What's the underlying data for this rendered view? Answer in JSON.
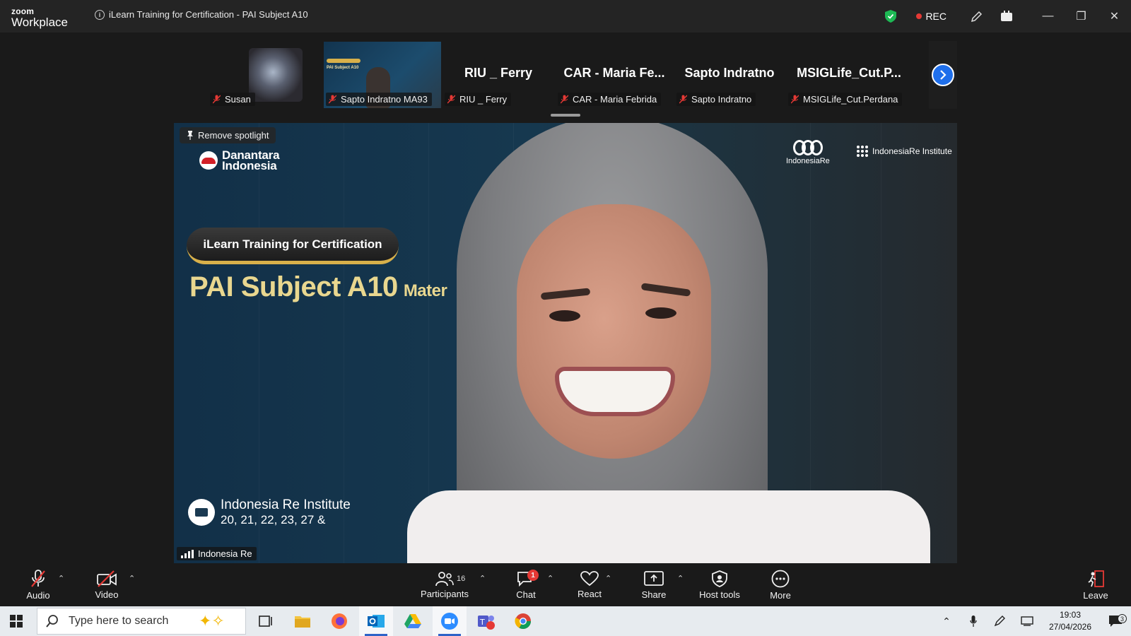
{
  "titlebar": {
    "brand_top": "zoom",
    "brand_bottom": "Workplace",
    "meeting_title": "iLearn Training for Certification - PAI Subject A10",
    "rec_label": "REC"
  },
  "participants_strip": [
    {
      "name": "Susan",
      "type": "photo"
    },
    {
      "name": "Sapto Indratno MA93",
      "type": "slide"
    },
    {
      "name": "RIU _ Ferry",
      "display": "RIU _ Ferry",
      "type": "name"
    },
    {
      "name": "CAR - Maria Febrida",
      "display": "CAR - Maria Fe...",
      "type": "name"
    },
    {
      "name": "Sapto Indratno",
      "display": "Sapto Indratno",
      "type": "name"
    },
    {
      "name": "MSIGLife_Cut.Perdana",
      "display": "MSIGLife_Cut.P...",
      "type": "name"
    }
  ],
  "main_video": {
    "spotlight_label": "Remove spotlight",
    "brand_line1": "Danantara",
    "brand_line2": "Indonesia",
    "logo_right1": "IndonesiaRe",
    "logo_right2": "IndonesiaRe Institute",
    "cert_pill": "iLearn Training for Certification",
    "subject": "PAI Subject A10",
    "subject_suffix": "Mater",
    "institute_line1": "Indonesia Re Institute",
    "institute_line2": "20, 21, 22, 23, 27 &",
    "speaker_label": "Indonesia Re"
  },
  "toolbar": {
    "audio": "Audio",
    "video": "Video",
    "participants": "Participants",
    "participants_count": "16",
    "chat": "Chat",
    "chat_badge": "1",
    "react": "React",
    "share": "Share",
    "host_tools": "Host tools",
    "more": "More",
    "leave": "Leave"
  },
  "taskbar": {
    "search_placeholder": "Type here to search",
    "time": "19:03",
    "date": "27/04/2026",
    "notification_count": "3"
  },
  "colors": {
    "accent_blue": "#1f6feb",
    "rec_red": "#e53935",
    "shield_green": "#1db954",
    "slide_gold": "#e9d78f"
  }
}
